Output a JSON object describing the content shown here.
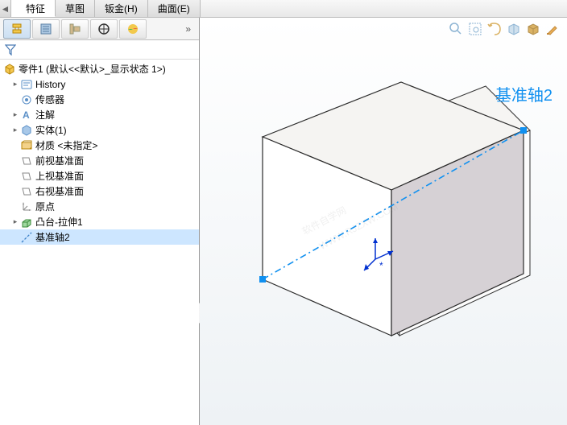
{
  "tabs": {
    "feature": "特征",
    "sketch": "草图",
    "sheetmetal": "钣金(H)",
    "surface": "曲面(E)"
  },
  "tree": {
    "root": "零件1  (默认<<默认>_显示状态 1>)",
    "history": "History",
    "sensors": "传感器",
    "annotations": "注解",
    "bodies": "实体(1)",
    "material": "材质 <未指定>",
    "front_plane": "前视基准面",
    "top_plane": "上视基准面",
    "right_plane": "右视基准面",
    "origin": "原点",
    "extrude": "凸台-拉伸1",
    "axis2": "基准轴2"
  },
  "viewport": {
    "axis_label": "基准轴2"
  },
  "view_buttons": {
    "zoom_fit": "zoom-fit",
    "zoom_area": "zoom-area",
    "prev_view": "prev-view",
    "section": "section-view",
    "display_style": "display-style",
    "edit_appearance": "edit-appearance"
  }
}
